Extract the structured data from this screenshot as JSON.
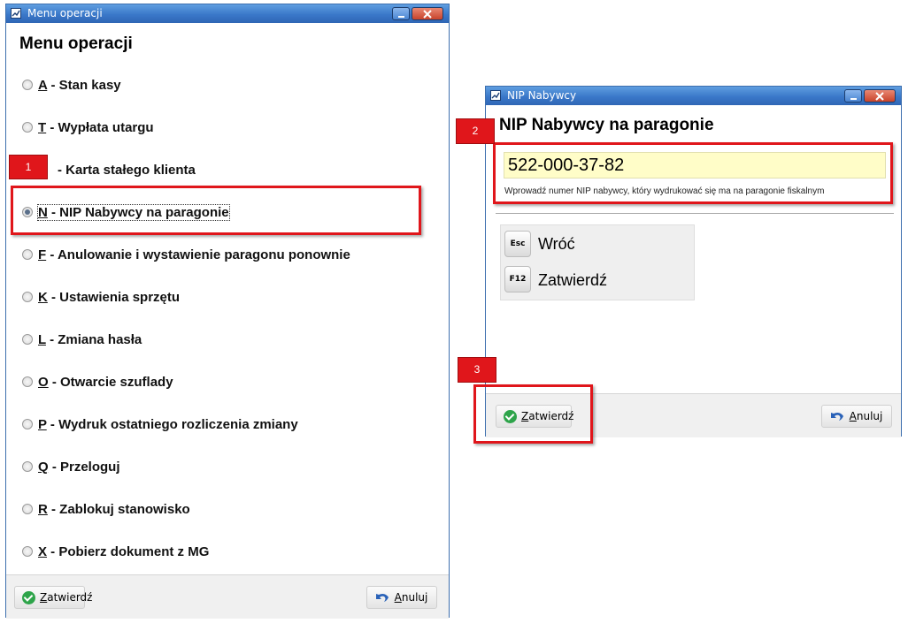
{
  "menu_window": {
    "title": "Menu operacji",
    "heading": "Menu operacji",
    "items": [
      {
        "key": "A",
        "label": " - Stan kasy"
      },
      {
        "key": "T",
        "label": " - Wypłata utargu"
      },
      {
        "key": "",
        "label": "- Karta stałego klienta"
      },
      {
        "key": "N",
        "label": " - NIP Nabywcy na paragonie"
      },
      {
        "key": "F",
        "label": " - Anulowanie i wystawienie paragonu ponownie"
      },
      {
        "key": "K",
        "label": " - Ustawienia sprzętu"
      },
      {
        "key": "L",
        "label": " - Zmiana hasła"
      },
      {
        "key": "O",
        "label": " - Otwarcie szuflady"
      },
      {
        "key": "P",
        "label": " - Wydruk ostatniego rozliczenia zmiany"
      },
      {
        "key": "Q",
        "label": " - Przeloguj"
      },
      {
        "key": "R",
        "label": " - Zablokuj stanowisko"
      },
      {
        "key": "X",
        "label": " - Pobierz dokument z MG"
      }
    ],
    "confirm_label": "Zatwierdź",
    "cancel_label": "Anuluj"
  },
  "nip_window": {
    "title": "NIP Nabywcy",
    "heading": "NIP Nabywcy na paragonie",
    "input_value": "522-000-37-82",
    "hint": "Wprowadź numer NIP nabywcy, który wydrukować się ma na paragonie fiskalnym",
    "keys": [
      {
        "cap": "Esc",
        "label": "Wróć"
      },
      {
        "cap": "F12",
        "label": "Zatwierdź"
      }
    ],
    "confirm_label": "Zatwierdź",
    "cancel_label": "Anuluj"
  },
  "markers": [
    "1",
    "2",
    "3"
  ],
  "colors": {
    "titlebar": "#3a78c9",
    "highlight": "#e0161b",
    "input_bg": "#fffdc8",
    "ok_green": "#2ea44a"
  }
}
